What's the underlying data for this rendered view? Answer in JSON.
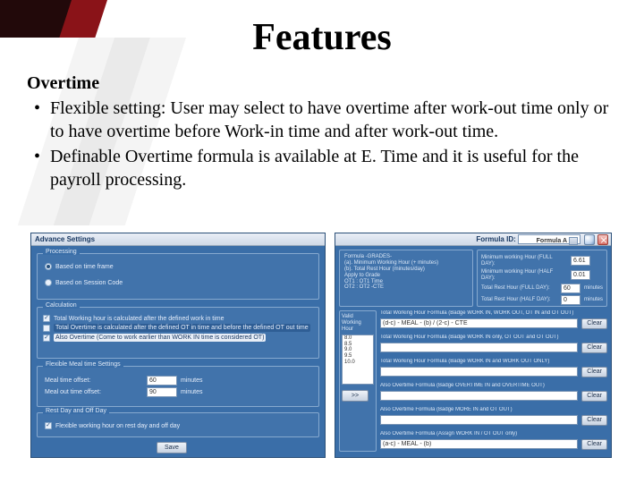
{
  "title": "Features",
  "section_heading": "Overtime",
  "bullets": [
    "Flexible setting: User may select to have overtime after work-out time only or to have overtime before Work-in time and after work-out time.",
    "Definable Overtime formula is available at E. Time and it is useful for the payroll processing."
  ],
  "left_shot": {
    "header": "Advance Settings",
    "processing": {
      "label": "Processing",
      "opt1": "Based on time frame",
      "opt2": "Based on Session Code"
    },
    "calculation": {
      "label": "Calculation",
      "chk1": "Total Working hour is calculated after the defined work in time",
      "chk2": "Total Overtime is calculated after the defined OT in time and before the defined OT out time",
      "chk3": "Also Overtime (Come to work earlier than WORK IN time is considered OT)"
    },
    "meal": {
      "label": "Flexible Meal time Settings",
      "row1_label": "Meal time offset:",
      "row1_val": "60",
      "row2_label": "Meal out time offset:",
      "row2_val": "90",
      "unit": "minutes"
    },
    "rest": {
      "label": "Rest Day and Off Day",
      "chk": "Flexible working hour on rest day and off day"
    },
    "save": "Save"
  },
  "right_shot": {
    "header_label": "Formula ID:",
    "header_value": "Formula A",
    "grades_label": "Formula -GRADES-",
    "grades_lines": [
      "(a). Minimum Working Hour (+ minutes)",
      "(b). Total Rest Hour (minutes/day)",
      "Apply to Grade",
      "OT1 : OT1 Time",
      "OT2 : OT2 -CTE"
    ],
    "criteria": [
      {
        "label": "Minimum working Hour (FULL DAY):",
        "val": "6.61"
      },
      {
        "label": "Minimum working Hour (HALF DAY):",
        "val": "0.01"
      },
      {
        "label": "Total Rest Hour (FULL DAY):",
        "val": "60"
      },
      {
        "label": "Total Rest Hour (HALF DAY):",
        "val": "0"
      }
    ],
    "criteria_unit": "minutes",
    "hourlist_label": "Valid Working Hour",
    "hourlist_items": [
      "8.0",
      "8.5",
      "9.0",
      "9.5",
      "10.0"
    ],
    "formula_rows": [
      {
        "title": "Total Working Hour Formula (Badge WORK IN, WORK OUT, OT IN and OT OUT)",
        "expr": "(d-c) - MEAL - (b) / (2-c) - CTE"
      },
      {
        "title": "Total Working Hour Formula (Badge WORK IN only, OT OUT and OT OUT)",
        "expr": ""
      },
      {
        "title": "Total Working Hour Formula (Badge WORK IN and WORK OUT ONLY)",
        "expr": ""
      },
      {
        "title": "Also Overtime Formula (Badge OVERTIME IN and OVERTIME OUT)",
        "expr": ""
      },
      {
        "title": "Also Overtime Formula (Badge MORE IN and OT OUT)",
        "expr": ""
      },
      {
        "title": "Also Overtime Formula (Assign WORK IN / OT OUT only)",
        "expr": "(a-c) - MEAL - (b)"
      }
    ],
    "clear": "Clear",
    "arrow_btn": ">>"
  }
}
